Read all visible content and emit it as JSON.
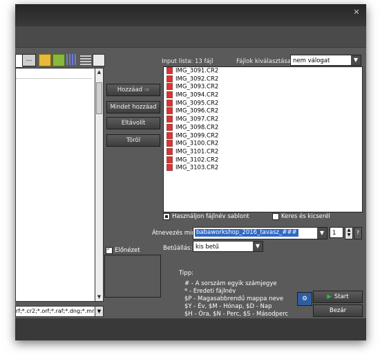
{
  "window": {
    "close_glyph": "✕"
  },
  "toolbar": {
    "browse_label": "..."
  },
  "filter": {
    "value": "rf;*.cr2;*.orf;*.raf;*.dng;*.mr"
  },
  "buttons": {
    "add": "Hozzáad",
    "add_all": "Mindet hozzáad",
    "remove": "Eltávolít",
    "clear": "Töröl"
  },
  "input_list": {
    "label": "Input lista:",
    "count": "13 fájl"
  },
  "file_select": {
    "label": "Fájlok kiválasztása:",
    "value": "nem válogat"
  },
  "files": [
    "IMG_3091.CR2",
    "IMG_3092.CR2",
    "IMG_3093.CR2",
    "IMG_3094.CR2",
    "IMG_3095.CR2",
    "IMG_3096.CR2",
    "IMG_3097.CR2",
    "IMG_3098.CR2",
    "IMG_3099.CR2",
    "IMG_3100.CR2",
    "IMG_3101.CR2",
    "IMG_3102.CR2",
    "IMG_3103.CR2"
  ],
  "options": {
    "use_template": "Használjon fájlnév sablont",
    "find_replace": "Keres és kicserél",
    "preview": "Előnézet"
  },
  "rename": {
    "label": "Átnevezés mint:",
    "value": "babaworkshop_2016_tavasz_###",
    "counter": "1",
    "help": "?"
  },
  "case": {
    "label": "Betűállás:",
    "value": "kis betű"
  },
  "tips": {
    "title": "Tipp:",
    "line1": "#  - A sorszám egyik számjegye",
    "line2": "*  - Eredeti fájlnév",
    "line3": "$P - Magasabbrendű mappa neve",
    "line4": "$Y - Év,     $M - Hónap,     $D - Nap",
    "line5": "$H - Óra,     $N - Perc,     $S - Másodperc"
  },
  "actions": {
    "start": "Start",
    "close": "Bezár"
  },
  "icons": {
    "folder_up": "folder-up-icon",
    "folder_new": "folder-new-icon",
    "view_thumbs": "thumbnails-view-icon",
    "view_list": "list-view-icon",
    "view_details": "details-view-icon",
    "file": "raw-file-icon",
    "play": "play-icon"
  },
  "colors": {
    "accent": "#2f68c4",
    "start_green": "#27c23a",
    "background": "#5a5a5a"
  }
}
